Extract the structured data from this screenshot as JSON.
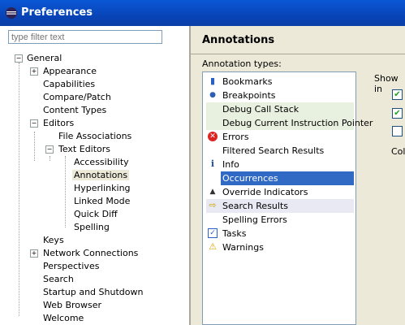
{
  "window": {
    "title": "Preferences"
  },
  "filter": {
    "placeholder": "type filter text"
  },
  "tree": [
    "General",
    "Appearance",
    "Capabilities",
    "Compare/Patch",
    "Content Types",
    "Editors",
    "File Associations",
    "Text Editors",
    "Accessibility",
    "Annotations",
    "Hyperlinking",
    "Linked Mode",
    "Quick Diff",
    "Spelling",
    "Keys",
    "Network Connections",
    "Perspectives",
    "Search",
    "Startup and Shutdown",
    "Web Browser",
    "Welcome"
  ],
  "page": {
    "title": "Annotations",
    "types_label": "Annotation types:",
    "show_in_label": "Show in",
    "color_label": "Colo"
  },
  "annotation_types": [
    "Bookmarks",
    "Breakpoints",
    "Debug Call Stack",
    "Debug Current Instruction Pointer",
    "Errors",
    "Filtered Search Results",
    "Info",
    "Occurrences",
    "Override Indicators",
    "Search Results",
    "Spelling Errors",
    "Tasks",
    "Warnings"
  ]
}
